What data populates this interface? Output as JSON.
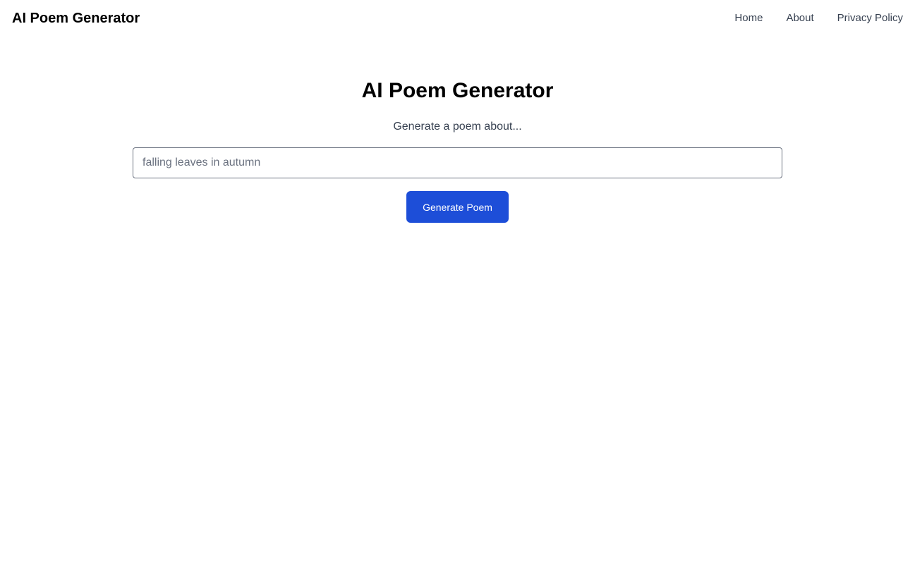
{
  "header": {
    "brand": "AI Poem Generator",
    "nav": [
      {
        "label": "Home"
      },
      {
        "label": "About"
      },
      {
        "label": "Privacy Policy"
      }
    ]
  },
  "main": {
    "title": "AI Poem Generator",
    "prompt_label": "Generate a poem about...",
    "topic_input": {
      "value": "",
      "placeholder": "falling leaves in autumn"
    },
    "generate_button_label": "Generate Poem"
  },
  "colors": {
    "accent": "#1d4ed8",
    "text": "#000000",
    "muted_text": "#374151",
    "input_border": "#6b7280",
    "background": "#ffffff"
  }
}
